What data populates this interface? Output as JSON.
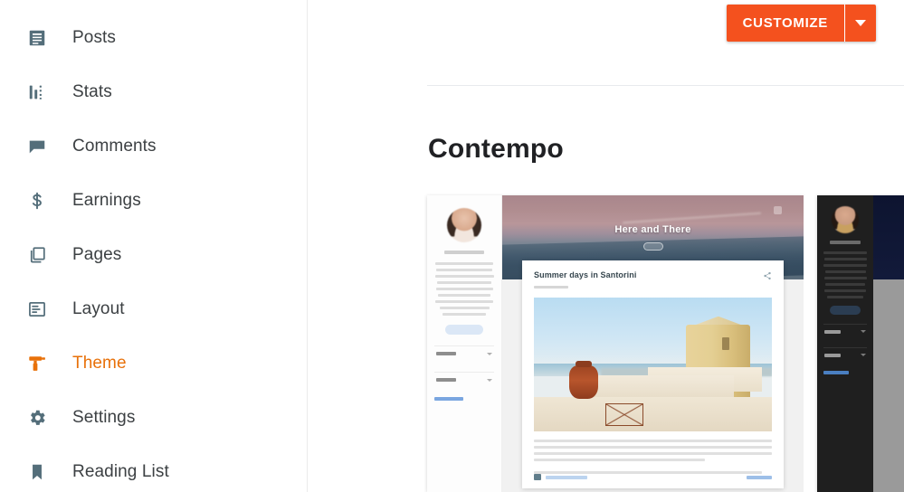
{
  "sidebar": {
    "items": [
      {
        "label": "Posts",
        "icon": "posts-icon",
        "active": false
      },
      {
        "label": "Stats",
        "icon": "stats-icon",
        "active": false
      },
      {
        "label": "Comments",
        "icon": "comments-icon",
        "active": false
      },
      {
        "label": "Earnings",
        "icon": "earnings-icon",
        "active": false
      },
      {
        "label": "Pages",
        "icon": "pages-icon",
        "active": false
      },
      {
        "label": "Layout",
        "icon": "layout-icon",
        "active": false
      },
      {
        "label": "Theme",
        "icon": "theme-icon",
        "active": true
      },
      {
        "label": "Settings",
        "icon": "settings-gear-icon",
        "active": false
      },
      {
        "label": "Reading List",
        "icon": "bookmark-icon",
        "active": false
      }
    ]
  },
  "toolbar": {
    "customize_label": "CUSTOMIZE",
    "dropdown_icon": "chevron-down-icon",
    "accent_color": "#f4511e"
  },
  "main": {
    "page_title": "Contempo"
  },
  "theme_preview": {
    "light": {
      "hero_title": "Here and There",
      "post_title": "Summer days in Santorini",
      "menu_icon": "hamburger-menu-icon",
      "share_icon": "share-icon",
      "comment_icon": "comment-icon"
    },
    "dark": {
      "variant": "dark"
    }
  },
  "colors": {
    "accent": "#f4511e",
    "theme_active": "#e8710a",
    "icon": "#546e7a",
    "text": "#3c4043",
    "title": "#202124"
  }
}
